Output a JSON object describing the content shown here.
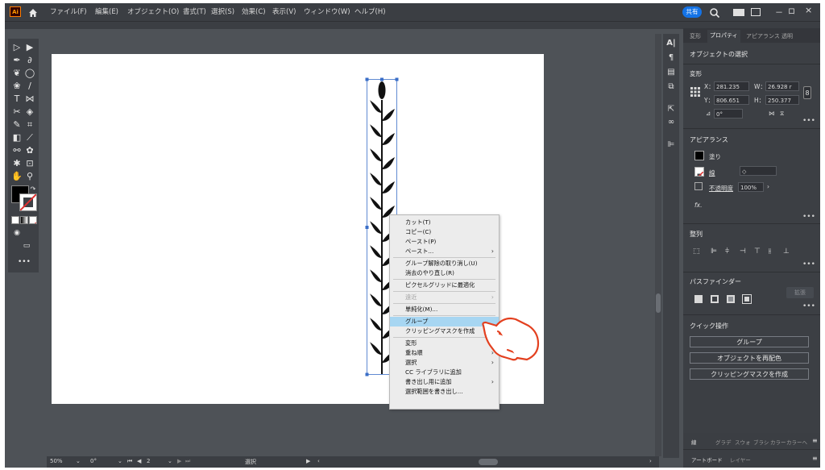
{
  "app": {
    "logo": "Ai",
    "home_icon": "home-icon",
    "menus": [
      "ファイル(F)",
      "編集(E)",
      "オブジェクト(O)",
      "書式(T)",
      "選択(S)",
      "効果(C)",
      "表示(V)",
      "ウィンドウ(W)",
      "ヘルプ(H)"
    ],
    "share_label": "共有",
    "window_controls": [
      "－",
      "ロ",
      "×"
    ]
  },
  "properties": {
    "tabs": [
      "変形",
      "プロパティ",
      "アピアランス",
      "透明"
    ],
    "object_state": "オブジェクトの選択",
    "transform": {
      "title": "変形",
      "x_label": "X：",
      "x_value": "281.235",
      "y_label": "Y：",
      "y_value": "806.651",
      "w_label": "W：",
      "w_value": "26.928 r",
      "h_label": "H：",
      "h_value": "250.377",
      "angle_value": "0°"
    },
    "appearance": {
      "title": "アピアランス",
      "fill_label": "塗り",
      "stroke_label": "線",
      "opacity_label": "不透明度",
      "opacity_value": "100%",
      "fx_label": "fx."
    },
    "align_title": "整列",
    "pathfinder": {
      "title": "パスファインダー",
      "expand_label": "拡張"
    },
    "quick_actions": {
      "title": "クイック操作",
      "buttons": [
        "グループ",
        "オブジェクトを再配色",
        "クリッピングマスクを作成"
      ]
    },
    "bottom_tabs_1": [
      "線",
      "グラデ",
      "スウォ",
      "ブラシ",
      "カラー",
      "カラーヘ"
    ],
    "bottom_tabs_2": [
      "アートボード",
      "レイヤー"
    ]
  },
  "context_menu": {
    "items": [
      {
        "label": "カット(T)",
        "disabled": false,
        "submenu": false,
        "highlight": false
      },
      {
        "label": "コピー(C)",
        "disabled": false,
        "submenu": false,
        "highlight": false
      },
      {
        "label": "ペースト(P)",
        "disabled": false,
        "submenu": false,
        "highlight": false
      },
      {
        "label": "ペースト...",
        "disabled": false,
        "submenu": true,
        "highlight": false
      },
      {
        "sep": true
      },
      {
        "label": "グループ解除の取り消し(U)",
        "disabled": false,
        "submenu": false,
        "highlight": false
      },
      {
        "label": "消去のやり直し(R)",
        "disabled": false,
        "submenu": false,
        "highlight": false
      },
      {
        "sep": true
      },
      {
        "label": "ピクセルグリッドに最適化",
        "disabled": false,
        "submenu": false,
        "highlight": false
      },
      {
        "sep": true
      },
      {
        "label": "遠近",
        "disabled": true,
        "submenu": true,
        "highlight": false
      },
      {
        "sep": true
      },
      {
        "label": "単純化(M)...",
        "disabled": false,
        "submenu": false,
        "highlight": false
      },
      {
        "sep": true
      },
      {
        "label": "グループ",
        "disabled": false,
        "submenu": false,
        "highlight": true
      },
      {
        "label": "クリッピングマスクを作成",
        "disabled": false,
        "submenu": false,
        "highlight": false
      },
      {
        "sep": true
      },
      {
        "label": "変形",
        "disabled": false,
        "submenu": true,
        "highlight": false
      },
      {
        "label": "重ね順",
        "disabled": false,
        "submenu": true,
        "highlight": false
      },
      {
        "label": "選択",
        "disabled": false,
        "submenu": true,
        "highlight": false
      },
      {
        "label": "CC ライブラリに追加",
        "disabled": false,
        "submenu": false,
        "highlight": false
      },
      {
        "label": "書き出し用に追加",
        "disabled": false,
        "submenu": true,
        "highlight": false
      },
      {
        "label": "選択範囲を書き出し...",
        "disabled": false,
        "submenu": false,
        "highlight": false
      }
    ]
  },
  "status": {
    "zoom": "50%",
    "rotation": "0°",
    "artboard_number": "2",
    "tool_name": "選択"
  },
  "colors": {
    "accent": "#1473e6",
    "menu_highlight": "#a7d6f2",
    "hand_cursor": "#e3401f"
  }
}
